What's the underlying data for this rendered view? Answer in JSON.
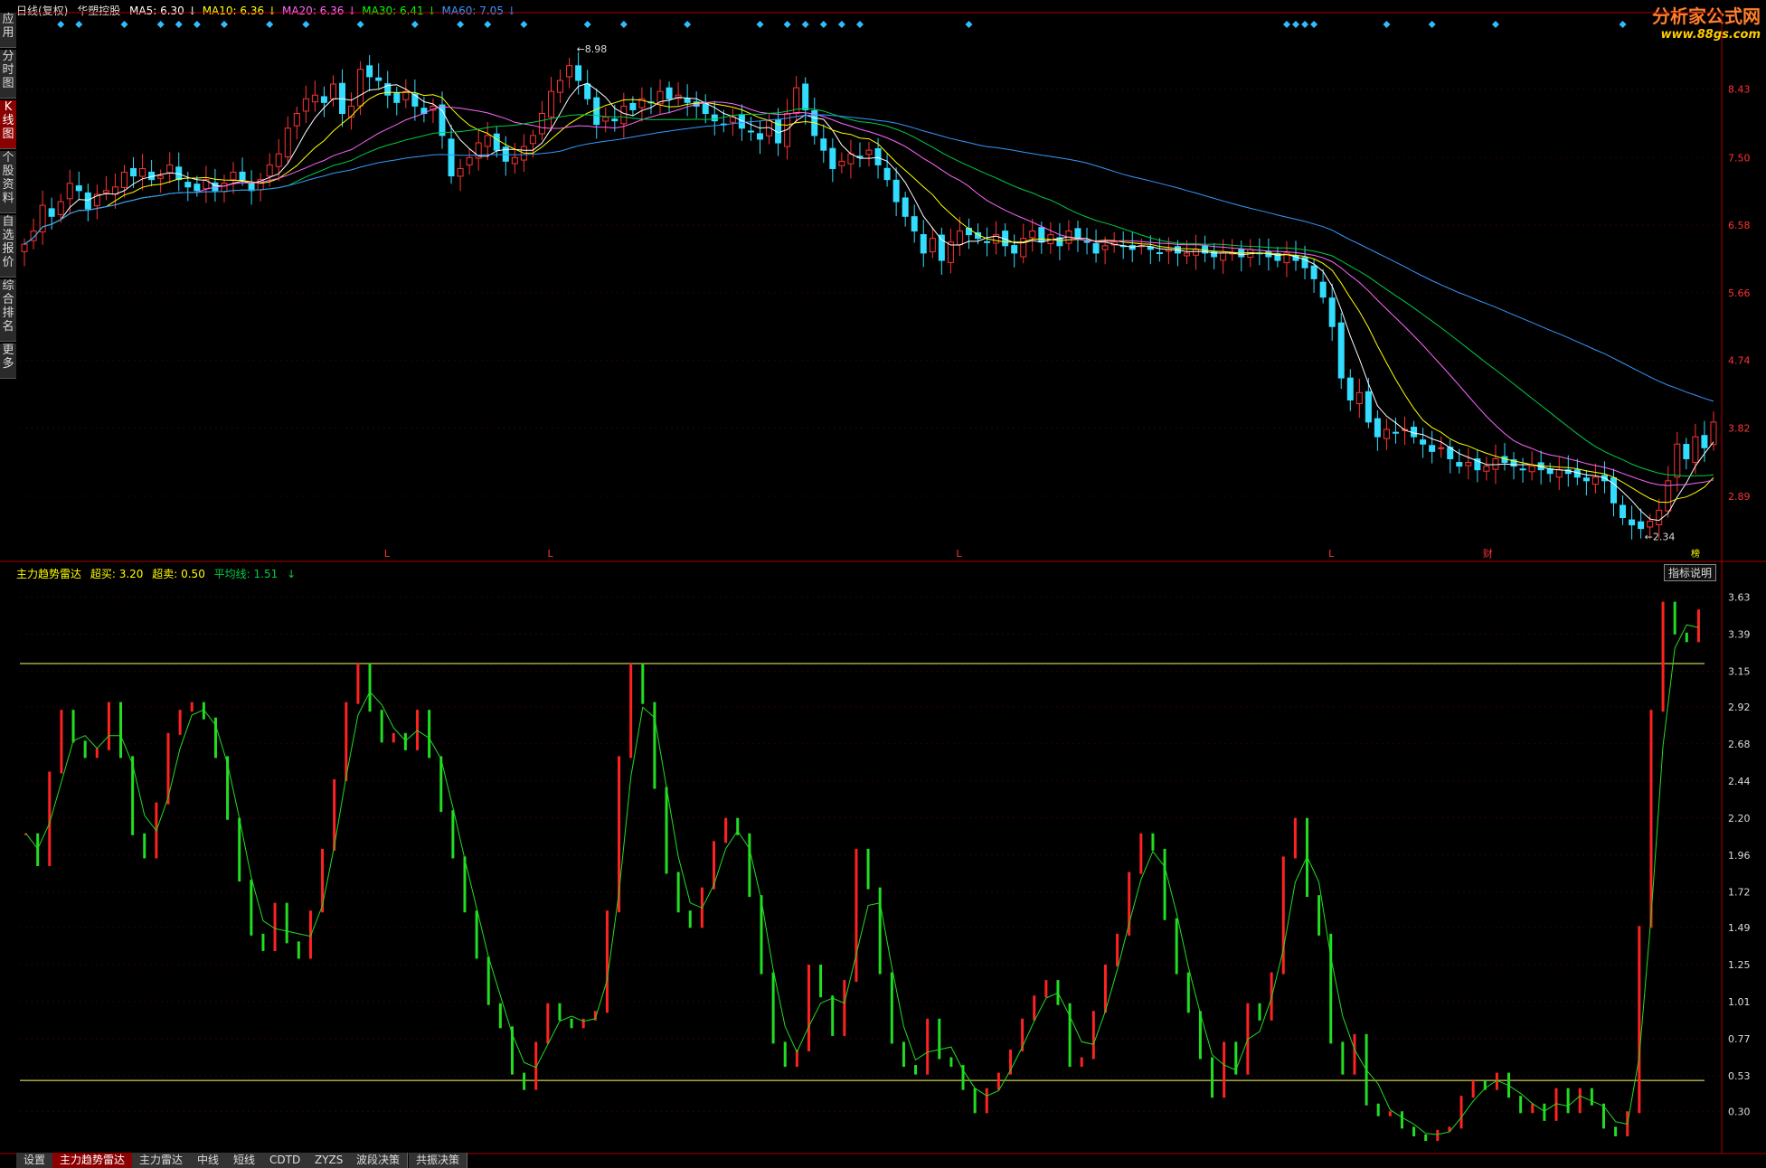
{
  "header": {
    "period": "日线(复权)",
    "stock": "华塑控股",
    "ma": [
      {
        "label": "MA5: 6.30",
        "color": "#ffffff"
      },
      {
        "label": "MA10: 6.36",
        "color": "#ffff00"
      },
      {
        "label": "MA20: 6.36",
        "color": "#ff66ff"
      },
      {
        "label": "MA30: 6.41",
        "color": "#00ff00"
      },
      {
        "label": "MA60: 7.05",
        "color": "#3399ff"
      }
    ],
    "arrow": "↓"
  },
  "indicator_header": {
    "name": "主力趋势雷达",
    "buy": "超买: 3.20",
    "sell": "超卖: 0.50",
    "avg": "平均线: 1.51",
    "arrow": "↓",
    "explain": "指标说明"
  },
  "left_tabs": [
    "应用",
    "分时图",
    "K线图",
    "个股资料",
    "自选报价",
    "综合排名",
    "更多"
  ],
  "bottom_tabs": [
    "设置",
    "主力趋势雷达",
    "主力雷达",
    "中线",
    "短线",
    "CDTD",
    "ZYZS",
    "波段决策",
    "共振决策"
  ],
  "logo": {
    "line1": "分析家公式网",
    "line2": "www.88gs.com"
  },
  "chart_data": [
    {
      "type": "candlestick",
      "name": "price",
      "yticks": [
        8.43,
        7.5,
        6.58,
        5.66,
        4.74,
        3.82,
        2.89
      ],
      "ylim": [
        2.2,
        9.3
      ],
      "high_label": "8.98",
      "low_label": "2.34",
      "bottom_marks": [
        {
          "i": 40,
          "t": "L"
        },
        {
          "i": 58,
          "t": "L"
        },
        {
          "i": 103,
          "t": "L"
        },
        {
          "i": 144,
          "t": "L"
        },
        {
          "i": 161,
          "t": "财"
        }
      ],
      "corner_mark": "榜",
      "close": [
        6.32,
        6.5,
        6.85,
        6.7,
        6.9,
        7.15,
        7.05,
        6.8,
        7.0,
        7.05,
        7.1,
        7.3,
        7.25,
        7.35,
        7.2,
        7.25,
        7.4,
        7.2,
        7.1,
        7.05,
        7.2,
        7.05,
        7.15,
        7.3,
        7.2,
        7.05,
        7.2,
        7.4,
        7.55,
        7.9,
        8.1,
        8.3,
        8.35,
        8.25,
        8.5,
        8.1,
        8.2,
        8.7,
        8.6,
        8.55,
        8.35,
        8.25,
        8.4,
        8.2,
        8.1,
        8.2,
        7.8,
        7.25,
        7.35,
        7.5,
        7.7,
        7.8,
        7.6,
        7.45,
        7.5,
        7.65,
        7.8,
        8.1,
        8.4,
        8.55,
        8.75,
        8.55,
        8.3,
        7.95,
        8.05,
        8.0,
        8.2,
        8.15,
        8.3,
        8.25,
        8.4,
        8.3,
        8.35,
        8.25,
        8.2,
        8.1,
        8.0,
        7.95,
        8.05,
        7.9,
        7.85,
        7.75,
        8.0,
        7.7,
        8.1,
        8.45,
        8.15,
        7.8,
        7.6,
        7.35,
        7.45,
        7.55,
        7.5,
        7.6,
        7.4,
        7.2,
        6.9,
        6.7,
        6.5,
        6.2,
        6.4,
        6.1,
        6.35,
        6.5,
        6.45,
        6.4,
        6.35,
        6.45,
        6.3,
        6.2,
        6.4,
        6.5,
        6.35,
        6.45,
        6.3,
        6.5,
        6.4,
        6.35,
        6.2,
        6.3,
        6.35,
        6.3,
        6.25,
        6.3,
        6.25,
        6.2,
        6.25,
        6.2,
        6.2,
        6.25,
        6.2,
        6.15,
        6.2,
        6.2,
        6.15,
        6.25,
        6.2,
        6.15,
        6.1,
        6.2,
        6.1,
        6.0,
        5.85,
        5.6,
        5.2,
        4.5,
        4.2,
        4.3,
        3.9,
        3.7,
        3.8,
        3.75,
        3.8,
        3.7,
        3.6,
        3.5,
        3.55,
        3.4,
        3.3,
        3.35,
        3.25,
        3.3,
        3.4,
        3.35,
        3.3,
        3.25,
        3.3,
        3.25,
        3.2,
        3.25,
        3.2,
        3.15,
        3.1,
        3.15,
        3.1,
        2.8,
        2.6,
        2.5,
        2.45,
        2.55,
        2.7,
        3.1,
        3.6,
        3.4,
        3.7,
        3.55,
        3.9
      ]
    },
    {
      "type": "bar",
      "name": "主力趋势雷达",
      "yticks": [
        3.63,
        3.39,
        3.15,
        2.92,
        2.68,
        2.44,
        2.2,
        1.96,
        1.72,
        1.49,
        1.25,
        1.01,
        0.77,
        0.53,
        0.3
      ],
      "ylim": [
        0.05,
        3.75
      ],
      "levels": [
        3.2,
        0.5
      ],
      "values": [
        2.1,
        1.9,
        2.5,
        2.9,
        2.7,
        2.6,
        2.65,
        2.95,
        2.6,
        2.1,
        1.95,
        2.3,
        2.75,
        2.9,
        2.95,
        2.85,
        2.6,
        2.2,
        1.8,
        1.45,
        1.35,
        1.65,
        1.4,
        1.3,
        1.6,
        2.0,
        2.45,
        2.95,
        3.2,
        2.9,
        2.7,
        2.75,
        2.65,
        2.9,
        2.6,
        2.25,
        1.95,
        1.6,
        1.3,
        1.0,
        0.85,
        0.55,
        0.45,
        0.75,
        1.0,
        0.9,
        0.85,
        0.9,
        0.95,
        1.6,
        2.6,
        3.2,
        2.95,
        2.4,
        1.85,
        1.6,
        1.5,
        1.75,
        2.05,
        2.2,
        2.1,
        1.7,
        1.2,
        0.75,
        0.6,
        0.7,
        1.25,
        1.05,
        0.8,
        1.15,
        2.0,
        1.75,
        1.2,
        0.75,
        0.6,
        0.55,
        0.9,
        0.65,
        0.6,
        0.45,
        0.3,
        0.45,
        0.55,
        0.7,
        0.9,
        1.05,
        1.15,
        1.0,
        0.6,
        0.65,
        0.95,
        1.25,
        1.45,
        1.85,
        2.1,
        2.0,
        1.55,
        1.2,
        0.95,
        0.65,
        0.4,
        0.75,
        0.55,
        1.0,
        0.9,
        1.2,
        1.95,
        2.2,
        1.7,
        1.45,
        0.75,
        0.55,
        0.8,
        0.35,
        0.28,
        0.3,
        0.2,
        0.15,
        0.12,
        0.18,
        0.2,
        0.4,
        0.5,
        0.45,
        0.55,
        0.4,
        0.3,
        0.35,
        0.25,
        0.45,
        0.3,
        0.45,
        0.35,
        0.2,
        0.15,
        0.3,
        1.5,
        2.9,
        3.6,
        3.4,
        3.35,
        3.55
      ]
    }
  ]
}
